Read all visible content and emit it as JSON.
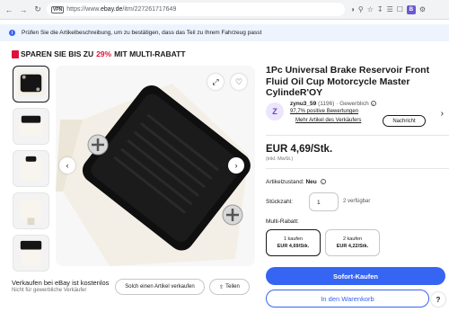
{
  "browser": {
    "vpn_badge": "VPN",
    "url_prefix": "https://www.",
    "url_domain": "ebay.de",
    "url_path": "/itm/227261717649"
  },
  "banner": {
    "text": "Prüfen Sie die Artikelbeschreibung, um zu bestätigen, dass das Teil zu Ihrem Fahrzeug passt"
  },
  "promo": {
    "prefix": "SPAREN SIE BIS ZU",
    "percent": "29%",
    "suffix": "MIT MULTI-RABATT",
    "accent_color": "#e0103a"
  },
  "product": {
    "title": "1Pc Universal Brake Reservoir Front Fluid Oil Cup Motorcycle Master CylindeR'OY",
    "price": "EUR 4,69/Stk.",
    "vat_note": "(inkl. MwSt.)"
  },
  "seller": {
    "avatar_letter": "Z",
    "name": "zynu3_59",
    "rating_count": "(1196)",
    "type": "· Gewerblich",
    "feedback": "97,7% positive Bewertungen",
    "more_items": "Mehr Artikel des Verkäufers",
    "message_label": "Nachricht"
  },
  "details": {
    "condition_label": "Artikelzustand:",
    "condition_value": "Neu",
    "quantity_label": "Stückzahl:",
    "quantity_value": "1",
    "available": "2 verfügbar",
    "multi_label": "Multi-Rabatt:",
    "tiers": [
      {
        "qty": "1 kaufen",
        "price": "EUR 4,69/Stk."
      },
      {
        "qty": "2 kaufen",
        "price": "EUR 4,22/Stk."
      }
    ]
  },
  "actions": {
    "buy_now": "Sofort-Kaufen",
    "add_to_cart": "In den Warenkorb",
    "help": "?",
    "primary_color": "#3665f3"
  },
  "sell_bar": {
    "title": "Verkaufen bei eBay ist kostenlos",
    "subtitle": "Nicht für gewerbliche Verkäufer",
    "sell_button": "Solch einen Artikel verkaufen",
    "share_button": "Teilen"
  },
  "icons": {
    "back": "back-arrow-icon",
    "forward": "forward-arrow-icon",
    "reload": "reload-icon",
    "info": "info-icon",
    "expand": "expand-icon",
    "watch": "heart-icon",
    "prev": "chevron-left-icon",
    "next": "chevron-right-icon"
  }
}
